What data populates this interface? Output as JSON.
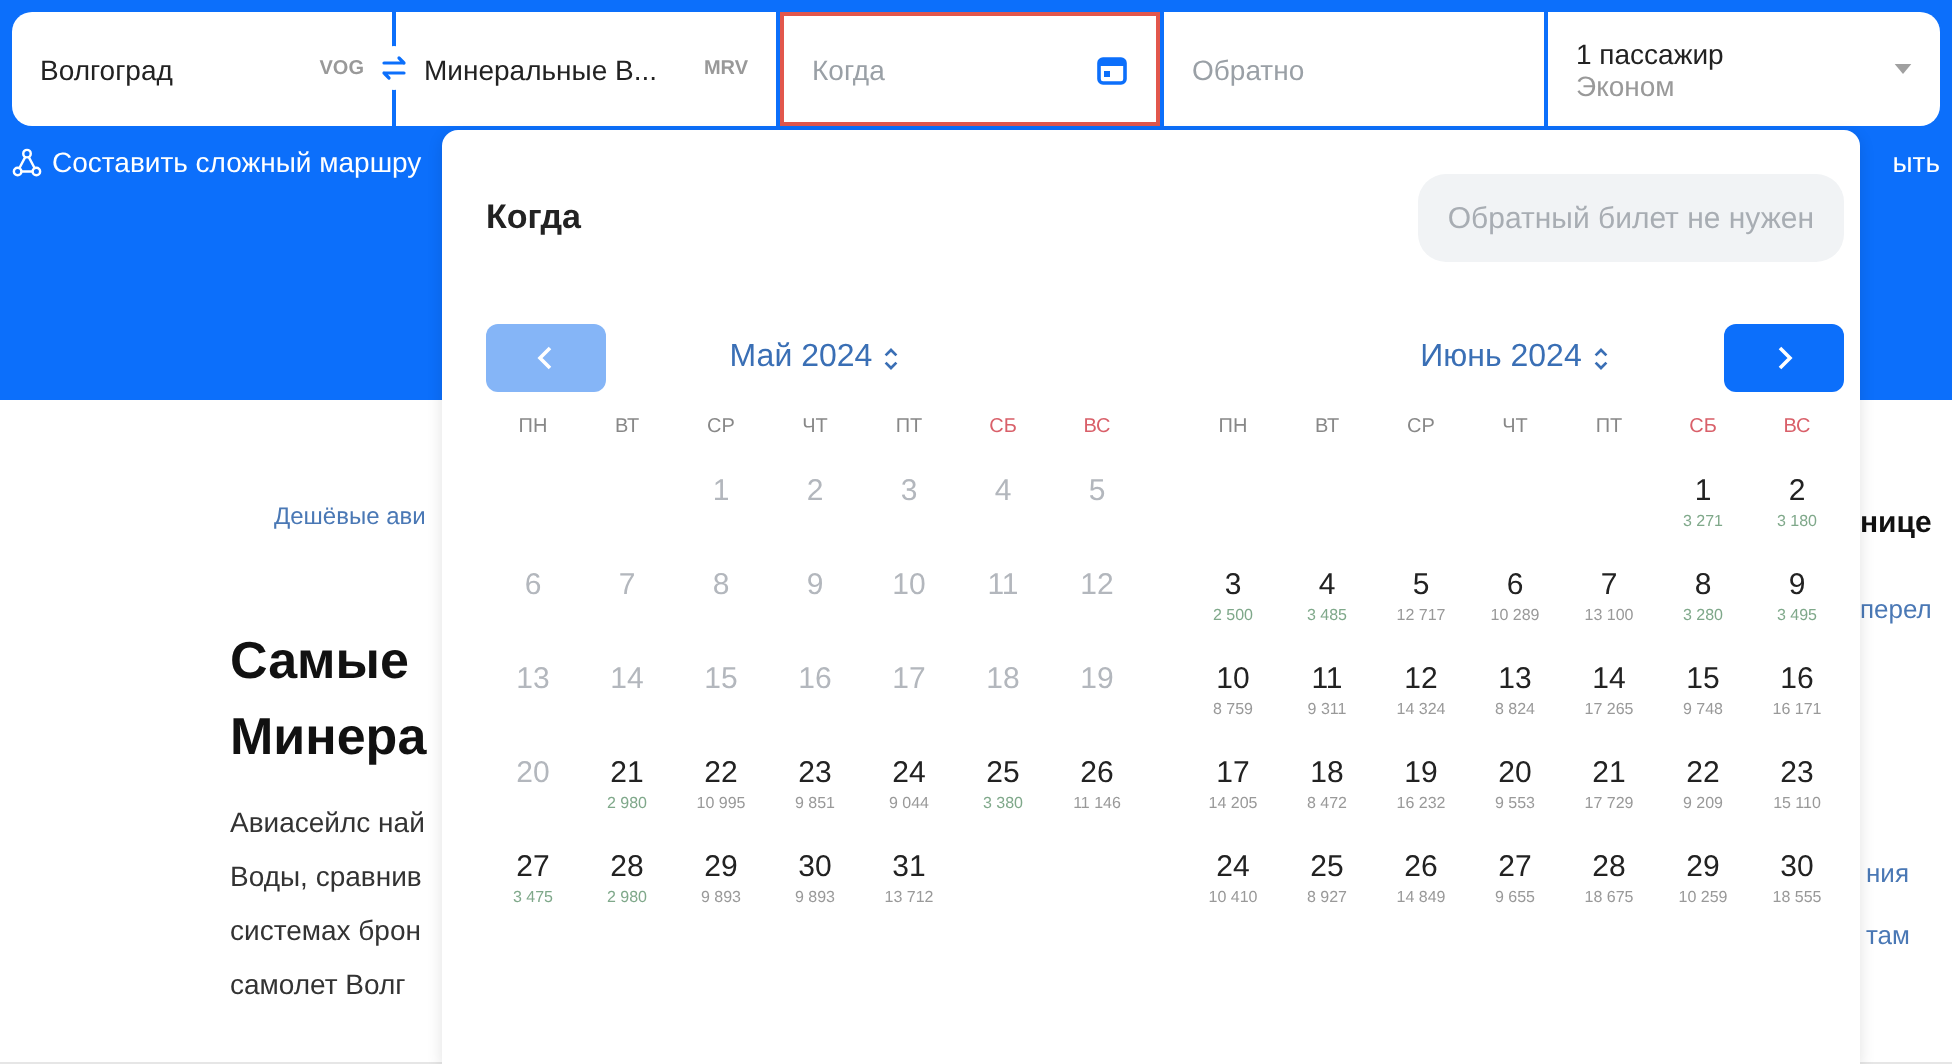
{
  "search_form": {
    "origin": {
      "city": "Волгоград",
      "code": "VOG"
    },
    "destination": {
      "city": "Минеральные В...",
      "code": "MRV"
    },
    "depart": {
      "placeholder": "Когда",
      "focused": true
    },
    "return": {
      "placeholder": "Обратно",
      "focused": false
    },
    "passengers": {
      "count": "1 пассажир",
      "class": "Эконом"
    }
  },
  "complex_route_link": "Составить сложный маршру",
  "header_right_text": "ыть",
  "page": {
    "breadcrumb": "Дешёвые ави",
    "heading": "Самые\nМинера",
    "paragraph": "Авиасейлс най\nВоды, сравнив\nсистемах брон\nсамолет Волг",
    "sidebar": {
      "heading": "нице",
      "links": [
        "перел",
        "ния",
        "там"
      ]
    }
  },
  "calendar": {
    "title": "Когда",
    "no_return_button": "Обратный билет не нужен",
    "prev_disabled": true,
    "next_disabled": false,
    "months": [
      {
        "title": "Май 2024",
        "weekdays": [
          {
            "label": "ПН",
            "weekend": false
          },
          {
            "label": "ВТ",
            "weekend": false
          },
          {
            "label": "СР",
            "weekend": false
          },
          {
            "label": "ЧТ",
            "weekend": false
          },
          {
            "label": "ПТ",
            "weekend": false
          },
          {
            "label": "СБ",
            "weekend": true
          },
          {
            "label": "ВС",
            "weekend": true
          }
        ],
        "weeks": [
          [
            {
              "kind": "empty"
            },
            {
              "kind": "empty"
            },
            {
              "kind": "day",
              "day": "1",
              "disabled": true
            },
            {
              "kind": "day",
              "day": "2",
              "disabled": true
            },
            {
              "kind": "day",
              "day": "3",
              "disabled": true
            },
            {
              "kind": "day",
              "day": "4",
              "disabled": true
            },
            {
              "kind": "day",
              "day": "5",
              "disabled": true
            }
          ],
          [
            {
              "kind": "day",
              "day": "6",
              "disabled": true
            },
            {
              "kind": "day",
              "day": "7",
              "disabled": true
            },
            {
              "kind": "day",
              "day": "8",
              "disabled": true
            },
            {
              "kind": "day",
              "day": "9",
              "disabled": true
            },
            {
              "kind": "day",
              "day": "10",
              "disabled": true
            },
            {
              "kind": "day",
              "day": "11",
              "disabled": true
            },
            {
              "kind": "day",
              "day": "12",
              "disabled": true
            }
          ],
          [
            {
              "kind": "day",
              "day": "13",
              "disabled": true
            },
            {
              "kind": "day",
              "day": "14",
              "disabled": true
            },
            {
              "kind": "day",
              "day": "15",
              "disabled": true
            },
            {
              "kind": "day",
              "day": "16",
              "disabled": true
            },
            {
              "kind": "day",
              "day": "17",
              "disabled": true
            },
            {
              "kind": "day",
              "day": "18",
              "disabled": true
            },
            {
              "kind": "day",
              "day": "19",
              "disabled": true
            }
          ],
          [
            {
              "kind": "day",
              "day": "20",
              "disabled": true
            },
            {
              "kind": "day",
              "day": "21",
              "disabled": false,
              "price": "2 980",
              "cheap": true
            },
            {
              "kind": "day",
              "day": "22",
              "disabled": false,
              "price": "10 995",
              "cheap": false
            },
            {
              "kind": "day",
              "day": "23",
              "disabled": false,
              "price": "9 851",
              "cheap": false
            },
            {
              "kind": "day",
              "day": "24",
              "disabled": false,
              "price": "9 044",
              "cheap": false
            },
            {
              "kind": "day",
              "day": "25",
              "disabled": false,
              "price": "3 380",
              "cheap": true
            },
            {
              "kind": "day",
              "day": "26",
              "disabled": false,
              "price": "11 146",
              "cheap": false
            }
          ],
          [
            {
              "kind": "day",
              "day": "27",
              "disabled": false,
              "price": "3 475",
              "cheap": true
            },
            {
              "kind": "day",
              "day": "28",
              "disabled": false,
              "price": "2 980",
              "cheap": true
            },
            {
              "kind": "day",
              "day": "29",
              "disabled": false,
              "price": "9 893",
              "cheap": false
            },
            {
              "kind": "day",
              "day": "30",
              "disabled": false,
              "price": "9 893",
              "cheap": false
            },
            {
              "kind": "day",
              "day": "31",
              "disabled": false,
              "price": "13 712",
              "cheap": false
            },
            {
              "kind": "empty"
            },
            {
              "kind": "empty"
            }
          ]
        ]
      },
      {
        "title": "Июнь 2024",
        "weekdays": [
          {
            "label": "ПН",
            "weekend": false
          },
          {
            "label": "ВТ",
            "weekend": false
          },
          {
            "label": "СР",
            "weekend": false
          },
          {
            "label": "ЧТ",
            "weekend": false
          },
          {
            "label": "ПТ",
            "weekend": false
          },
          {
            "label": "СБ",
            "weekend": true
          },
          {
            "label": "ВС",
            "weekend": true
          }
        ],
        "weeks": [
          [
            {
              "kind": "empty"
            },
            {
              "kind": "empty"
            },
            {
              "kind": "empty"
            },
            {
              "kind": "empty"
            },
            {
              "kind": "empty"
            },
            {
              "kind": "day",
              "day": "1",
              "disabled": false,
              "price": "3 271",
              "cheap": true
            },
            {
              "kind": "day",
              "day": "2",
              "disabled": false,
              "price": "3 180",
              "cheap": true
            }
          ],
          [
            {
              "kind": "day",
              "day": "3",
              "disabled": false,
              "price": "2 500",
              "cheap": true
            },
            {
              "kind": "day",
              "day": "4",
              "disabled": false,
              "price": "3 485",
              "cheap": true
            },
            {
              "kind": "day",
              "day": "5",
              "disabled": false,
              "price": "12 717",
              "cheap": false
            },
            {
              "kind": "day",
              "day": "6",
              "disabled": false,
              "price": "10 289",
              "cheap": false
            },
            {
              "kind": "day",
              "day": "7",
              "disabled": false,
              "price": "13 100",
              "cheap": false
            },
            {
              "kind": "day",
              "day": "8",
              "disabled": false,
              "price": "3 280",
              "cheap": true
            },
            {
              "kind": "day",
              "day": "9",
              "disabled": false,
              "price": "3 495",
              "cheap": true
            }
          ],
          [
            {
              "kind": "day",
              "day": "10",
              "disabled": false,
              "price": "8 759",
              "cheap": false
            },
            {
              "kind": "day",
              "day": "11",
              "disabled": false,
              "price": "9 311",
              "cheap": false
            },
            {
              "kind": "day",
              "day": "12",
              "disabled": false,
              "price": "14 324",
              "cheap": false
            },
            {
              "kind": "day",
              "day": "13",
              "disabled": false,
              "price": "8 824",
              "cheap": false
            },
            {
              "kind": "day",
              "day": "14",
              "disabled": false,
              "price": "17 265",
              "cheap": false
            },
            {
              "kind": "day",
              "day": "15",
              "disabled": false,
              "price": "9 748",
              "cheap": false
            },
            {
              "kind": "day",
              "day": "16",
              "disabled": false,
              "price": "16 171",
              "cheap": false
            }
          ],
          [
            {
              "kind": "day",
              "day": "17",
              "disabled": false,
              "price": "14 205",
              "cheap": false
            },
            {
              "kind": "day",
              "day": "18",
              "disabled": false,
              "price": "8 472",
              "cheap": false
            },
            {
              "kind": "day",
              "day": "19",
              "disabled": false,
              "price": "16 232",
              "cheap": false
            },
            {
              "kind": "day",
              "day": "20",
              "disabled": false,
              "price": "9 553",
              "cheap": false
            },
            {
              "kind": "day",
              "day": "21",
              "disabled": false,
              "price": "17 729",
              "cheap": false
            },
            {
              "kind": "day",
              "day": "22",
              "disabled": false,
              "price": "9 209",
              "cheap": false
            },
            {
              "kind": "day",
              "day": "23",
              "disabled": false,
              "price": "15 110",
              "cheap": false
            }
          ],
          [
            {
              "kind": "day",
              "day": "24",
              "disabled": false,
              "price": "10 410",
              "cheap": false
            },
            {
              "kind": "day",
              "day": "25",
              "disabled": false,
              "price": "8 927",
              "cheap": false
            },
            {
              "kind": "day",
              "day": "26",
              "disabled": false,
              "price": "14 849",
              "cheap": false
            },
            {
              "kind": "day",
              "day": "27",
              "disabled": false,
              "price": "9 655",
              "cheap": false
            },
            {
              "kind": "day",
              "day": "28",
              "disabled": false,
              "price": "18 675",
              "cheap": false
            },
            {
              "kind": "day",
              "day": "29",
              "disabled": false,
              "price": "10 259",
              "cheap": false
            },
            {
              "kind": "day",
              "day": "30",
              "disabled": false,
              "price": "18 555",
              "cheap": false
            }
          ]
        ]
      }
    ]
  }
}
